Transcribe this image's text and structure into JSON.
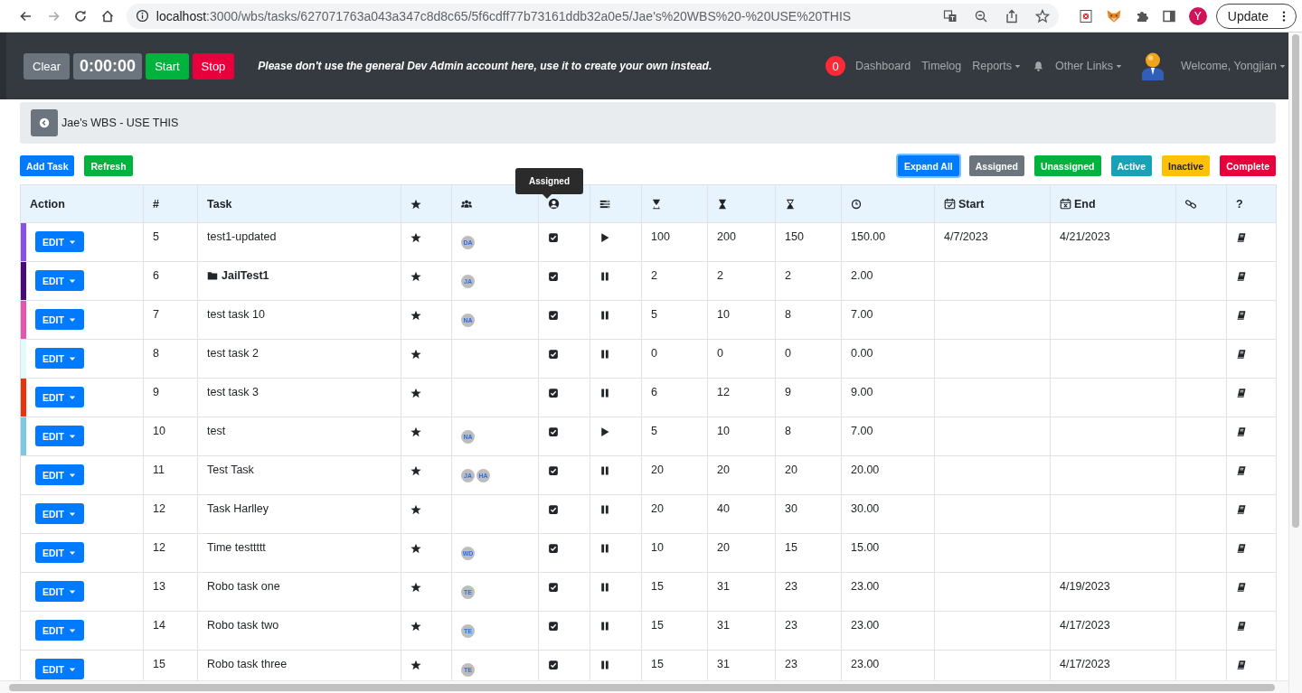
{
  "browser": {
    "url": {
      "host": "localhost",
      "path": ":3000/wbs/tasks/627071763a043a347c8d8c65/5f6cdff77b73161ddb32a0e5/Jae's%20WBS%20-%20USE%20THIS"
    },
    "profile_letter": "Y",
    "update_label": "Update"
  },
  "navbar": {
    "timer": {
      "clear": "Clear",
      "time": "0:00:00",
      "start": "Start",
      "stop": "Stop"
    },
    "notice": "Please don't use the general Dev Admin account here, use it to create your own instead.",
    "notification_count": "0",
    "links": [
      {
        "kind": "link",
        "label": "Dashboard"
      },
      {
        "kind": "link",
        "label": "Timelog"
      },
      {
        "kind": "dropdown",
        "label": "Reports"
      },
      {
        "kind": "bell"
      },
      {
        "kind": "dropdown",
        "label": "Other Links"
      }
    ],
    "welcome": "Welcome, Yongjian"
  },
  "breadcrumb": {
    "title": "Jae's WBS - USE THIS"
  },
  "actions": [
    {
      "kind": "primary",
      "label": "Add Task"
    },
    {
      "kind": "success",
      "label": "Refresh"
    }
  ],
  "filters": [
    {
      "kind": "primary",
      "label": "Expand All",
      "focused": true
    },
    {
      "kind": "secondary",
      "label": "Assigned",
      "focused": false
    },
    {
      "kind": "success",
      "label": "Unassigned",
      "focused": false
    },
    {
      "kind": "info",
      "label": "Active",
      "focused": false
    },
    {
      "kind": "warning",
      "label": "Inactive",
      "focused": false
    },
    {
      "kind": "danger",
      "label": "Complete",
      "focused": false
    }
  ],
  "table": {
    "tooltip": "Assigned",
    "columns": [
      {
        "kind": "text",
        "label": "Action"
      },
      {
        "kind": "text",
        "label": "#"
      },
      {
        "kind": "text",
        "label": "Task"
      },
      {
        "kind": "star"
      },
      {
        "kind": "team"
      },
      {
        "kind": "user"
      },
      {
        "kind": "bars"
      },
      {
        "kind": "hourglass-top"
      },
      {
        "kind": "hourglass-full"
      },
      {
        "kind": "hourglass-bottom"
      },
      {
        "kind": "clock"
      },
      {
        "kind": "calendar-check",
        "label": "Start"
      },
      {
        "kind": "calendar-x",
        "label": "End"
      },
      {
        "kind": "link"
      },
      {
        "kind": "text",
        "label": "?"
      }
    ],
    "rows": [
      {
        "color": "#8a4fe8",
        "edit": "EDIT",
        "number": "5",
        "task": "test1-updated",
        "folder": false,
        "members": [
          "DA"
        ],
        "assigned": true,
        "paused": false,
        "column_8": "100",
        "column_9": "200",
        "column_10": "150",
        "column_11": "150.00",
        "start": "4/7/2023",
        "end": "4/21/2023"
      },
      {
        "color": "#4b0a7a",
        "edit": "EDIT",
        "number": "6",
        "task": "JailTest1",
        "folder": true,
        "members": [
          "JA"
        ],
        "assigned": true,
        "paused": true,
        "column_8": "2",
        "column_9": "2",
        "column_10": "2",
        "column_11": "2.00"
      },
      {
        "color": "#e455b0",
        "edit": "EDIT",
        "number": "7",
        "task": "test task 10",
        "folder": false,
        "members": [
          "NA"
        ],
        "assigned": true,
        "paused": true,
        "column_8": "5",
        "column_9": "10",
        "column_10": "8",
        "column_11": "7.00"
      },
      {
        "color": "#e0fbfb",
        "edit": "EDIT",
        "number": "8",
        "task": "test task 2",
        "folder": false,
        "members": [],
        "assigned": true,
        "paused": true,
        "column_8": "0",
        "column_9": "0",
        "column_10": "0",
        "column_11": "0.00"
      },
      {
        "color": "#e8330c",
        "edit": "EDIT",
        "number": "9",
        "task": "test task 3",
        "folder": false,
        "members": [],
        "assigned": true,
        "paused": true,
        "column_8": "6",
        "column_9": "12",
        "column_10": "9",
        "column_11": "9.00"
      },
      {
        "color": "#7cc7e2",
        "edit": "EDIT",
        "number": "10",
        "task": "test",
        "folder": false,
        "members": [
          "NA"
        ],
        "assigned": true,
        "paused": false,
        "column_8": "5",
        "column_9": "10",
        "column_10": "8",
        "column_11": "7.00"
      },
      {
        "edit": "EDIT",
        "number": "11",
        "task": "Test Task",
        "folder": false,
        "members": [
          "JA",
          "HA"
        ],
        "assigned": true,
        "paused": true,
        "column_8": "20",
        "column_9": "20",
        "column_10": "20",
        "column_11": "20.00"
      },
      {
        "edit": "EDIT",
        "number": "12",
        "task": "Task Harlley",
        "folder": false,
        "members": [],
        "assigned": true,
        "paused": true,
        "column_8": "20",
        "column_9": "40",
        "column_10": "30",
        "column_11": "30.00"
      },
      {
        "edit": "EDIT",
        "number": "12",
        "task": "Time testtttt",
        "folder": false,
        "members": [
          "WD"
        ],
        "assigned": true,
        "paused": true,
        "column_8": "10",
        "column_9": "20",
        "column_10": "15",
        "column_11": "15.00"
      },
      {
        "edit": "EDIT",
        "number": "13",
        "task": "Robo task one",
        "folder": false,
        "members": [
          "TE"
        ],
        "assigned": true,
        "paused": true,
        "column_8": "15",
        "column_9": "31",
        "column_10": "23",
        "column_11": "23.00",
        "end": "4/19/2023"
      },
      {
        "edit": "EDIT",
        "number": "14",
        "task": "Robo task two",
        "folder": false,
        "members": [
          "TE"
        ],
        "assigned": true,
        "paused": true,
        "column_8": "15",
        "column_9": "31",
        "column_10": "23",
        "column_11": "23.00",
        "end": "4/17/2023"
      },
      {
        "edit": "EDIT",
        "number": "15",
        "task": "Robo task three",
        "folder": false,
        "members": [
          "TE"
        ],
        "assigned": true,
        "paused": true,
        "column_8": "15",
        "column_9": "31",
        "column_10": "23",
        "column_11": "23.00",
        "end": "4/17/2023"
      }
    ]
  }
}
